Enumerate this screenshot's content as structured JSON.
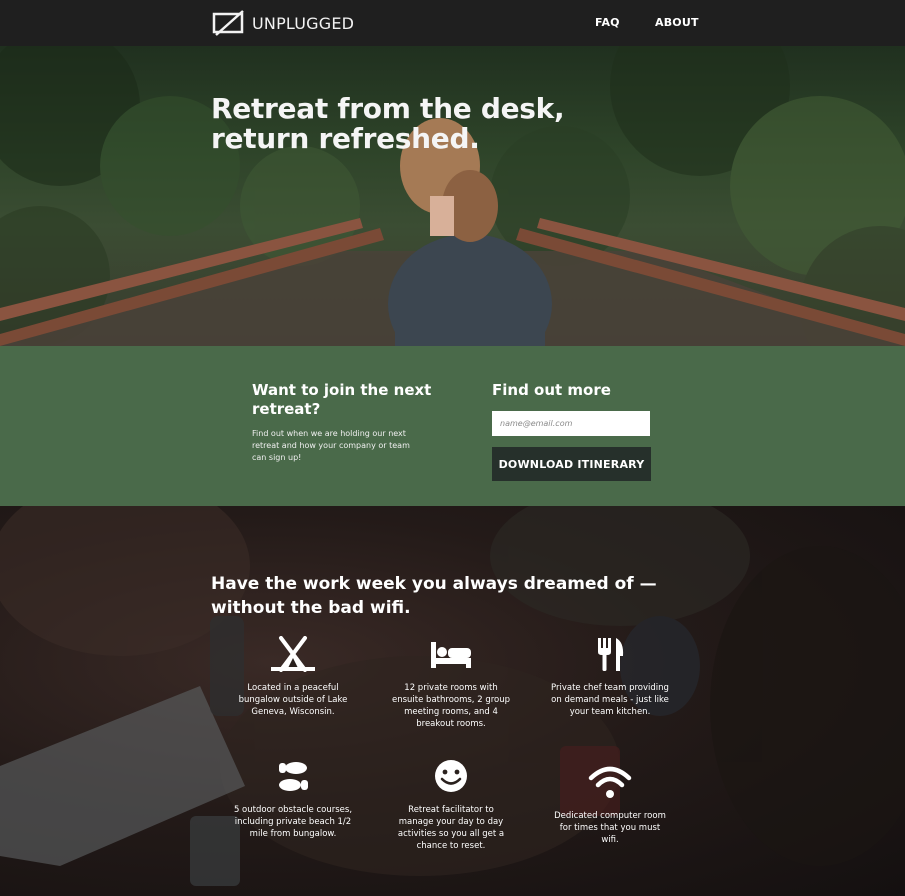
{
  "brand": {
    "name": "UNPLUGGED",
    "logo_icon": "unplugged-screen-icon"
  },
  "nav": {
    "faq": "FAQ",
    "about": "ABOUT"
  },
  "hero": {
    "title_line1": "Retreat from the desk,",
    "title_line2": "return refreshed."
  },
  "signup": {
    "heading": "Want to join the next retreat?",
    "text": "Find out when we are holding our next retreat and how your company or team can sign up!",
    "find_heading": "Find out more",
    "email_placeholder": "name@email.com",
    "button_label": "DOWNLOAD ITINERARY"
  },
  "features": {
    "title": "Have the work week you always dreamed of — without the bad wifi.",
    "items": [
      {
        "icon": "tent-icon",
        "text": "Located in a peaceful bungalow outside of Lake Geneva, Wisconsin."
      },
      {
        "icon": "bed-icon",
        "text": "12 private rooms with ensuite bathrooms, 2 group meeting rooms, and 4 breakout rooms."
      },
      {
        "icon": "utensils-icon",
        "text": "Private chef team providing on demand meals - just like your team kitchen."
      },
      {
        "icon": "shoe-prints-icon",
        "text": "5 outdoor obstacle courses, including private beach 1/2 mile from bungalow."
      },
      {
        "icon": "smile-icon",
        "text": "Retreat facilitator to manage your day to day activities so you all get a chance to reset."
      },
      {
        "icon": "wifi-icon",
        "text": "Dedicated computer room for times that you must wifi."
      }
    ]
  }
}
